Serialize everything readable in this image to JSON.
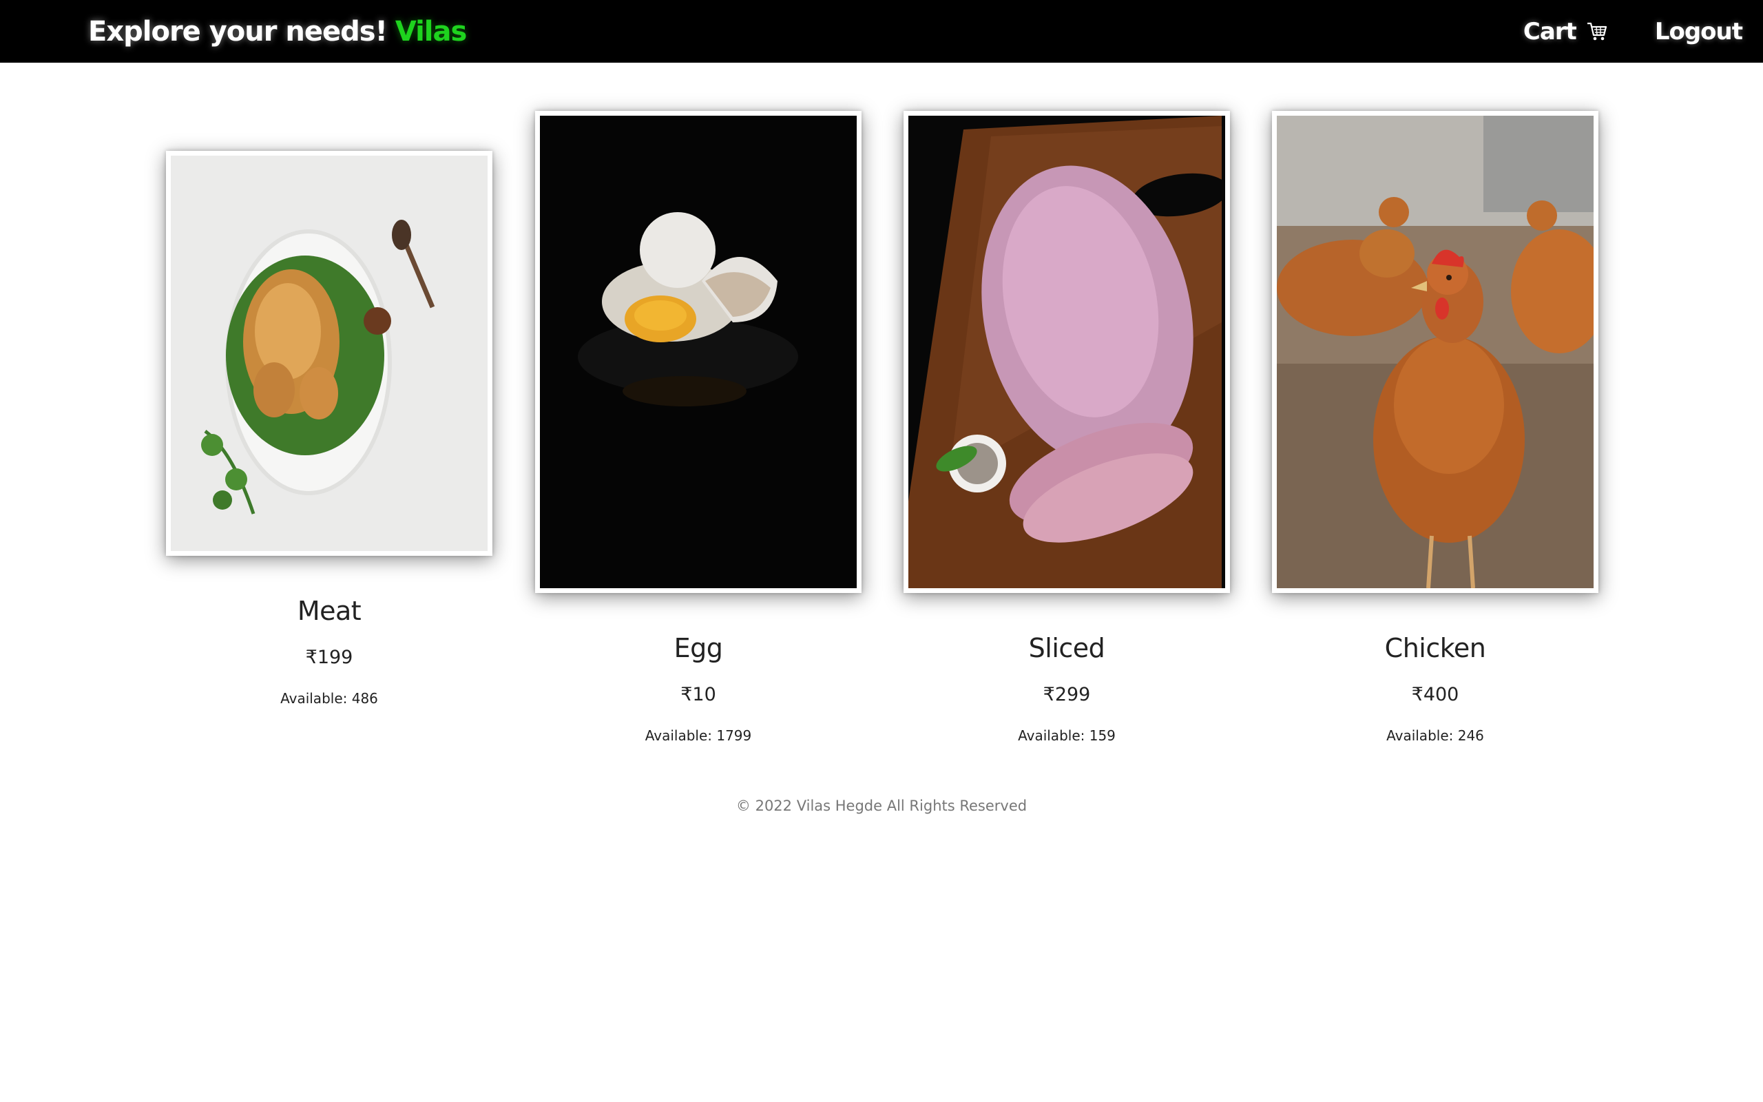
{
  "header": {
    "brand_prefix": "Explore your needs!",
    "brand_name": "Vilas",
    "cart_label": "Cart",
    "cart_icon": "cart-icon",
    "logout_label": "Logout",
    "accent_color": "#1ed31e"
  },
  "products": [
    {
      "name": "Meat",
      "price": "₹199",
      "available": "Available: 486",
      "image": "roast-chicken-photo"
    },
    {
      "name": "Egg",
      "price": "₹10",
      "available": "Available: 1799",
      "image": "cracked-egg-photo"
    },
    {
      "name": "Sliced",
      "price": "₹299",
      "available": "Available: 159",
      "image": "sliced-meat-board-photo"
    },
    {
      "name": "Chicken",
      "price": "₹400",
      "available": "Available: 246",
      "image": "live-hens-photo"
    }
  ],
  "footer": {
    "text": "© 2022 Vilas Hegde All Rights Reserved"
  }
}
